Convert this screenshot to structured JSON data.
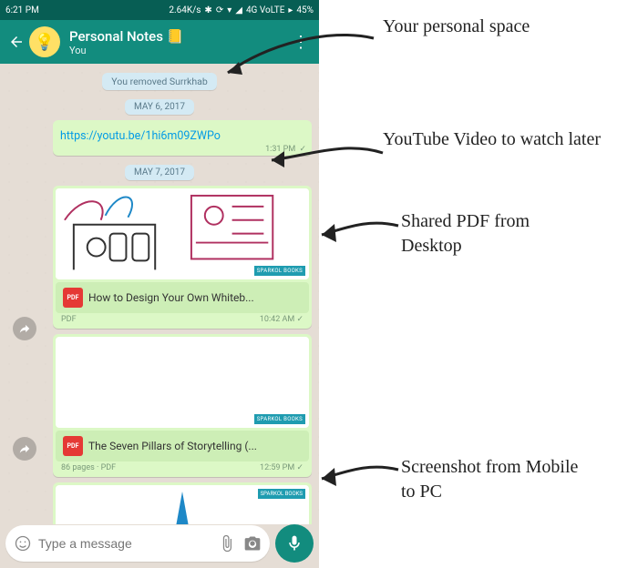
{
  "statusbar": {
    "time": "6:21 PM",
    "speed": "2.64K/s",
    "network": "4G VoLTE",
    "battery": "45%"
  },
  "header": {
    "title_a": "Personal Notes ",
    "note_icon": "📒",
    "subtitle": "You"
  },
  "system": {
    "removed": "You removed Surrkhab"
  },
  "dates": {
    "d1": "MAY 6, 2017",
    "d2": "MAY 7, 2017"
  },
  "link": {
    "url": "https://youtu.be/1hi6m09ZWPo",
    "time": "1:31 PM"
  },
  "pdf1": {
    "name": "How to Design Your Own Whiteb...",
    "meta_left": "PDF",
    "time": "10:42 AM",
    "badge": "SPARKOL BOOKS"
  },
  "pdf2": {
    "name": "The Seven Pillars of Storytelling (...",
    "meta_left": "86 pages · PDF",
    "time": "12:59 PM",
    "badge": "SPARKOL BOOKS"
  },
  "img1": {
    "badge": "SPARKOL BOOKS"
  },
  "input": {
    "placeholder": "Type a message"
  },
  "annotations": {
    "a1": "Your personal space",
    "a2": "YouTube Video to watch later",
    "a3": "Shared PDF from Desktop",
    "a4": "Screenshot from Mobile to PC"
  },
  "icons": {
    "bulb": "💡"
  }
}
